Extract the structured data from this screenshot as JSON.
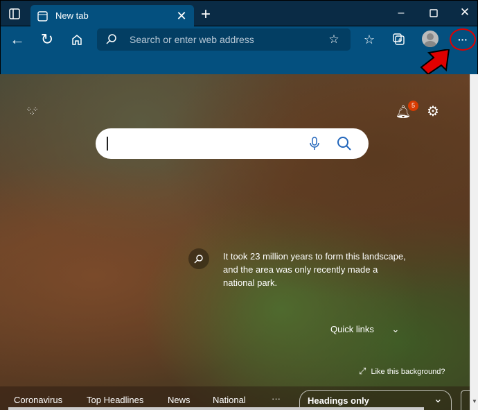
{
  "tab": {
    "title": "New tab"
  },
  "address": {
    "placeholder": "Search or enter web address"
  },
  "notifications": {
    "count": "5"
  },
  "background": {
    "caption": "It took 23 million years to form this landscape, and the area was only recently made a national park.",
    "like_label": "Like this background?"
  },
  "quick_links": {
    "label": "Quick links"
  },
  "news": {
    "tabs": [
      "Coronavirus",
      "Top Headlines",
      "News",
      "National"
    ],
    "more": "···",
    "layout_select": "Headings only"
  },
  "colors": {
    "titlebar": "#0a2b45",
    "toolbar": "#04507f",
    "annotation": "#e00000"
  }
}
